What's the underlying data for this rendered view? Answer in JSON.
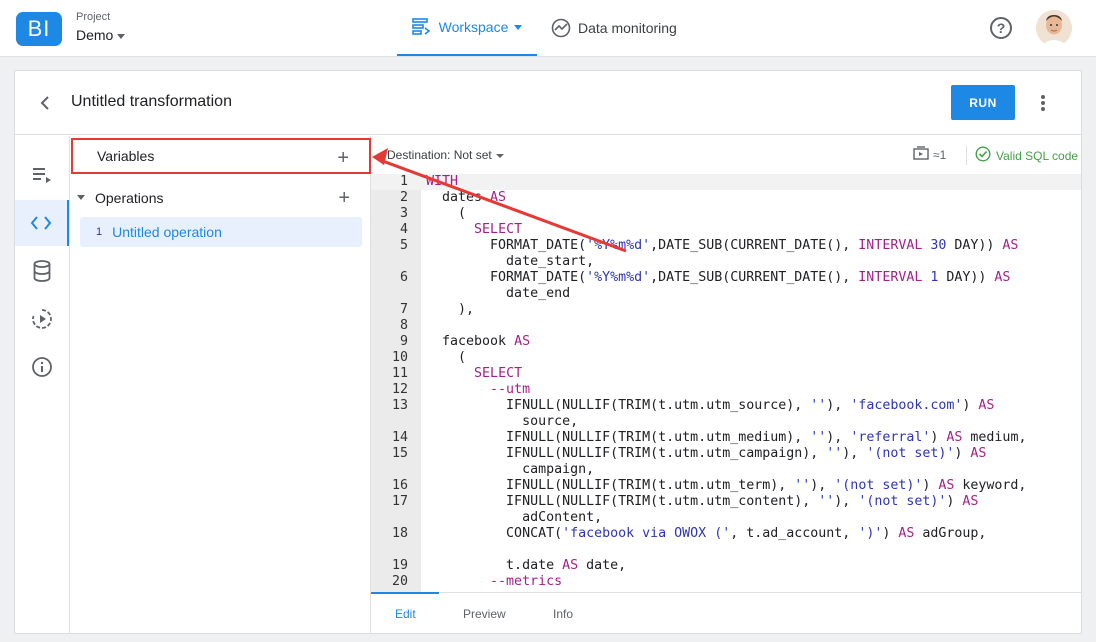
{
  "header": {
    "logo_text": "BI",
    "project_label": "Project",
    "project_name": "Demo",
    "nav": [
      {
        "label": "Workspace",
        "icon": "workspace-icon",
        "active": true
      },
      {
        "label": "Data monitoring",
        "icon": "monitoring-icon",
        "active": false
      }
    ],
    "help_glyph": "?"
  },
  "card": {
    "title": "Untitled transformation",
    "run_label": "RUN"
  },
  "rail": {
    "items": [
      "list-icon",
      "code-icon",
      "database-icon",
      "schedule-play-icon",
      "info-icon"
    ],
    "active": "code-icon"
  },
  "panel": {
    "variables_label": "Variables",
    "operations_label": "Operations",
    "plus": "+",
    "operations": [
      {
        "num": "1",
        "label": "Untitled operation"
      }
    ]
  },
  "editor": {
    "destination": "Destination: Not set",
    "bytes": "≈1",
    "valid": "Valid SQL code",
    "tabs": [
      "Edit",
      "Preview",
      "Info"
    ],
    "active_tab": "Edit"
  },
  "code": [
    {
      "n": "1",
      "t": "WITH"
    },
    {
      "n": "2",
      "t": "  dates AS"
    },
    {
      "n": "3",
      "t": "    ("
    },
    {
      "n": "4",
      "t": "      SELECT"
    },
    {
      "n": "5",
      "t": "        FORMAT_DATE('%Y%m%d',DATE_SUB(CURRENT_DATE(), INTERVAL 30 DAY)) AS"
    },
    {
      "n": "",
      "t": "          date_start,"
    },
    {
      "n": "6",
      "t": "        FORMAT_DATE('%Y%m%d',DATE_SUB(CURRENT_DATE(), INTERVAL 1 DAY)) AS"
    },
    {
      "n": "",
      "t": "          date_end"
    },
    {
      "n": "7",
      "t": "    ),"
    },
    {
      "n": "8",
      "t": ""
    },
    {
      "n": "9",
      "t": "  facebook AS"
    },
    {
      "n": "10",
      "t": "    ("
    },
    {
      "n": "11",
      "t": "      SELECT"
    },
    {
      "n": "12",
      "t": "        --utm"
    },
    {
      "n": "13",
      "t": "          IFNULL(NULLIF(TRIM(t.utm.utm_source), ''), 'facebook.com') AS"
    },
    {
      "n": "",
      "t": "            source,"
    },
    {
      "n": "14",
      "t": "          IFNULL(NULLIF(TRIM(t.utm.utm_medium), ''), 'referral') AS medium,"
    },
    {
      "n": "15",
      "t": "          IFNULL(NULLIF(TRIM(t.utm.utm_campaign), ''), '(not set)') AS"
    },
    {
      "n": "",
      "t": "            campaign,"
    },
    {
      "n": "16",
      "t": "          IFNULL(NULLIF(TRIM(t.utm.utm_term), ''), '(not set)') AS keyword,"
    },
    {
      "n": "17",
      "t": "          IFNULL(NULLIF(TRIM(t.utm.utm_content), ''), '(not set)') AS"
    },
    {
      "n": "",
      "t": "            adContent,"
    },
    {
      "n": "18",
      "t": "          CONCAT('facebook via OWOX (', t.ad_account, ')') AS adGroup,"
    },
    {
      "n": "",
      "t": ""
    },
    {
      "n": "19",
      "t": "          t.date AS date,"
    },
    {
      "n": "20",
      "t": "        --metrics"
    }
  ],
  "colors": {
    "accent": "#1e88e5",
    "highlight_box": "#e53935",
    "keyword": "#a41f8c",
    "string": "#2e35b7",
    "valid": "#43a047"
  }
}
